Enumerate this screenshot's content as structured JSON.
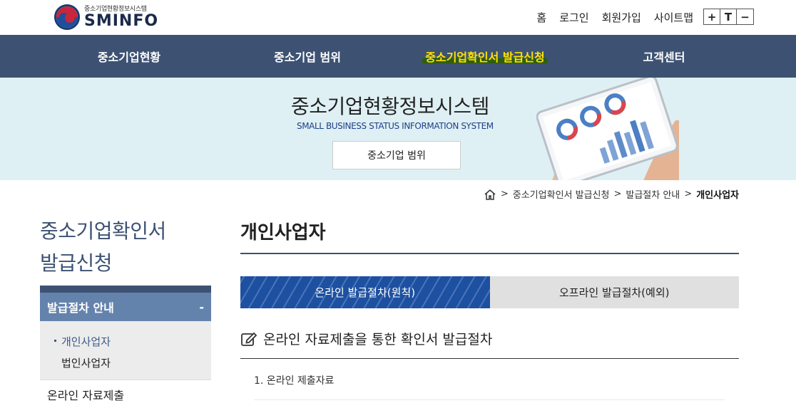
{
  "logo": {
    "small_text": "중소기업현황정보시스템",
    "name": "SMINFO"
  },
  "util_links": [
    "홈",
    "로그인",
    "회원가입",
    "사이트맵"
  ],
  "font_controls": [
    "+",
    "T",
    "−"
  ],
  "gnb": [
    "중소기업현황",
    "중소기업 범위",
    "중소기업확인서 발급신청",
    "고객센터"
  ],
  "hero": {
    "title": "중소기업현황정보시스템",
    "subtitle": "SMALL BUSINESS STATUS INFORMATION SYSTEM",
    "button": "중소기업 범위"
  },
  "breadcrumb": [
    "중소기업확인서 발급신청",
    "발급절차 안내",
    "개인사업자"
  ],
  "lnb": {
    "title_line1": "중소기업확인서",
    "title_line2": "발급신청",
    "section": "발급절차 안내",
    "section_toggle": "-",
    "sub_items": [
      "개인사업자",
      "법인사업자"
    ],
    "next_item": "온라인 자료제출"
  },
  "page_title": "개인사업자",
  "tabs": [
    "온라인 발급절차(원칙)",
    "오프라인 발급절차(예외)"
  ],
  "section_title": "온라인 자료제출을 통한 확인서 발급절차",
  "section_item": "1. 온라인 제출자료",
  "colors": {
    "nav": "#3d5273",
    "accent": "#1d50a0",
    "highlight": "#ffe100"
  }
}
